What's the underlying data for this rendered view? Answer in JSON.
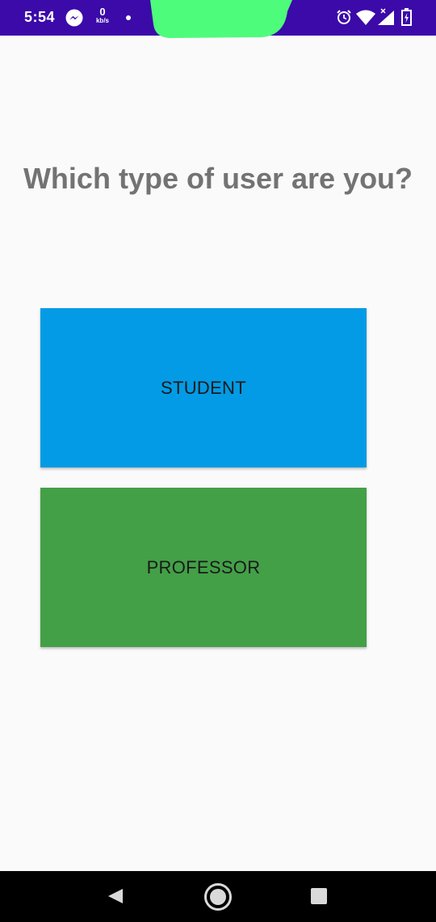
{
  "status_bar": {
    "time": "5:54",
    "network_speed_value": "0",
    "network_speed_unit": "kb/s",
    "background_color": "#3b0aa9",
    "icons": [
      "messenger-icon",
      "notification-dot",
      "alarm-icon",
      "wifi-icon",
      "signal-icon",
      "battery-icon"
    ]
  },
  "main": {
    "title": "Which type of user are you?",
    "options": [
      {
        "label": "STUDENT",
        "color": "#039be5"
      },
      {
        "label": "PROFESSOR",
        "color": "#43a047"
      }
    ]
  },
  "nav_bar": {
    "icons": [
      "back-icon",
      "home-icon",
      "recents-icon"
    ]
  }
}
